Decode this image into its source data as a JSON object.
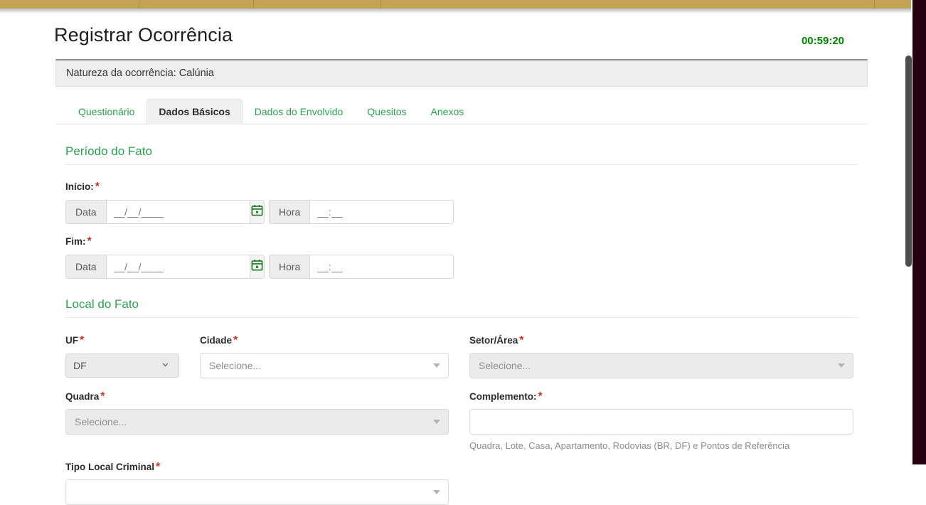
{
  "browser": {
    "tab_strip_color": "#c2a452",
    "tab_divider_positions": [
      196,
      357,
      536,
      1230
    ]
  },
  "header": {
    "title": "Registrar Ocorrência",
    "timer": "00:59:20",
    "timer_color": "#018000"
  },
  "panel": {
    "heading": "Natureza da ocorrência: Calúnia"
  },
  "tabs": [
    {
      "label": "Questionário",
      "active": false
    },
    {
      "label": "Dados Básicos",
      "active": true
    },
    {
      "label": "Dados do Envolvido",
      "active": false
    },
    {
      "label": "Quesitos",
      "active": false
    },
    {
      "label": "Anexos",
      "active": false
    }
  ],
  "sections": {
    "periodo": {
      "title": "Período do Fato",
      "inicio": {
        "label": "Início:",
        "required": "*",
        "data_addon": "Data",
        "data_placeholder": "__/__/____",
        "data_value": "",
        "calendar_icon": "calendar-icon",
        "hora_addon": "Hora",
        "hora_placeholder": "__:__",
        "hora_value": ""
      },
      "fim": {
        "label": "Fim:",
        "required": "*",
        "data_addon": "Data",
        "data_placeholder": "__/__/____",
        "data_value": "",
        "calendar_icon": "calendar-icon",
        "hora_addon": "Hora",
        "hora_placeholder": "__:__",
        "hora_value": ""
      }
    },
    "local": {
      "title": "Local do Fato",
      "uf": {
        "label": "UF",
        "required": "*",
        "value": "DF",
        "disabled": true
      },
      "cidade": {
        "label": "Cidade",
        "required": "*",
        "value": "Selecione...",
        "disabled": false
      },
      "setor_area": {
        "label": "Setor/Área",
        "required": "*",
        "value": "Selecione...",
        "disabled": true
      },
      "quadra": {
        "label": "Quadra",
        "required": "*",
        "value": "Selecione...",
        "disabled": true
      },
      "complemento": {
        "label": "Complemento:",
        "required": "*",
        "value": "",
        "help": "Quadra, Lote, Casa, Apartamento, Rodovias (BR, DF) e Pontos de Referência"
      },
      "tipo_local_criminal": {
        "label": "Tipo Local Criminal",
        "required": "*",
        "value": ""
      }
    }
  },
  "colors": {
    "accent_green": "#2e9e52",
    "required_red": "#c0392b",
    "gold_bar": "#c2a452"
  }
}
